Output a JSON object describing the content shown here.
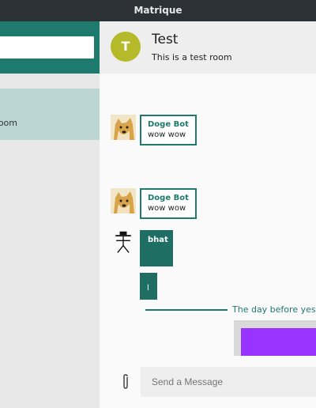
{
  "window": {
    "title": "Matrique"
  },
  "sidebar": {
    "search_value": "",
    "selected_room_snippet": "st room"
  },
  "room": {
    "avatar_letter": "T",
    "avatar_color": "#b5ba2a",
    "name": "Test",
    "topic": "This is a test room"
  },
  "timeline": {
    "messages": [
      {
        "sender": "Doge Bot",
        "body": "wow wow",
        "avatar": "doge-avatar-icon"
      },
      {
        "sender": "Doge Bot",
        "body": "wow wow",
        "avatar": "doge-avatar-icon"
      },
      {
        "sender": "bhat",
        "body": "",
        "avatar": "hat-figure-avatar-icon"
      },
      {
        "sender": "",
        "body": "l",
        "avatar": ""
      }
    ],
    "date_divider": "The day before yeste",
    "image_color": "#9933ff"
  },
  "composer": {
    "placeholder": "Send a Message",
    "attach_icon": "paperclip-icon"
  },
  "colors": {
    "accent": "#1f7a6e",
    "titlebar": "#2b3134",
    "selected_room": "#bcd6d3"
  }
}
